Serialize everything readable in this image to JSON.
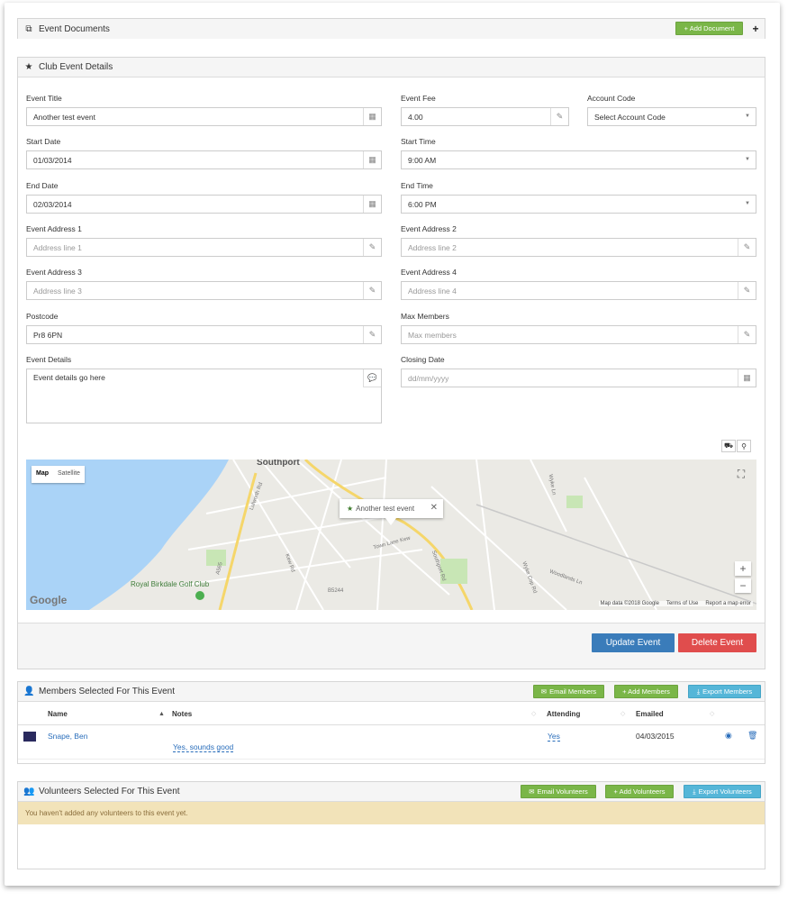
{
  "documents_panel": {
    "title": "Event Documents",
    "title_icon": "copy-icon",
    "add_button": "+ Add Document",
    "plus_icon": "plus-icon"
  },
  "details_panel": {
    "title": "Club Event Details",
    "title_icon": "star-icon",
    "labels": {
      "event_title": "Event Title",
      "event_fee": "Event Fee",
      "account_code": "Account Code",
      "start_date": "Start Date",
      "start_time": "Start Time",
      "end_date": "End Date",
      "end_time": "End Time",
      "address1": "Event Address 1",
      "address2": "Event Address 2",
      "address3": "Event Address 3",
      "address4": "Event Address 4",
      "postcode": "Postcode",
      "max_members": "Max Members",
      "event_details": "Event Details",
      "closing_date": "Closing Date"
    },
    "values": {
      "event_title": "Another test event",
      "event_fee": "4.00",
      "account_code": "Select Account Code",
      "start_date": "01/03/2014",
      "start_time": "9:00 AM",
      "end_date": "02/03/2014",
      "end_time": "6:00 PM",
      "postcode": "Pr8 6PN",
      "event_details": "Event details go here"
    },
    "placeholders": {
      "address1": "Address line 1",
      "address2": "Address line 2",
      "address3": "Address line 3",
      "address4": "Address line 4",
      "max_members": "Max members",
      "closing_date": "dd/mm/yyyy"
    },
    "map": {
      "type_map": "Map",
      "type_satellite": "Satellite",
      "info_text": "Another test event",
      "place_southport": "Southport",
      "place_golf": "Royal Birkdale Golf Club",
      "roads": [
        "Lulworth Rd",
        "A565",
        "Southport Rd",
        "Town Lane Kew",
        "B5244",
        "Woodlands Ln",
        "Wyke Cop Rd",
        "Wyke Ln",
        "Kew Rd"
      ],
      "logo": "Google",
      "attribution": "Map data ©2018 Google",
      "terms": "Terms of Use",
      "report": "Report a map error",
      "zoom_in": "+",
      "zoom_out": "−"
    },
    "update_button": "Update Event",
    "delete_button": "Delete Event"
  },
  "members_panel": {
    "title": "Members Selected For This Event",
    "title_icon": "user-icon",
    "email_button": "Email Members",
    "add_button": "+ Add Members",
    "export_button": "Export Members",
    "columns": [
      "Name",
      "Notes",
      "Attending",
      "Emailed"
    ],
    "rows": [
      {
        "name": "Snape, Ben",
        "notes": "Yes, sounds good",
        "attending": "Yes",
        "emailed": "04/03/2015"
      }
    ]
  },
  "volunteers_panel": {
    "title": "Volunteers Selected For This Event",
    "title_icon": "users-icon",
    "email_button": "Email Volunteers",
    "add_button": "+ Add Volunteers",
    "export_button": "Export Volunteers",
    "empty_message": "You haven't added any volunteers to this event yet."
  },
  "colors": {
    "green": "#7ab648",
    "blue_button": "#55b6d8",
    "update": "#3a7cba",
    "delete": "#e04d4d",
    "warning": "#f2e3b9"
  }
}
